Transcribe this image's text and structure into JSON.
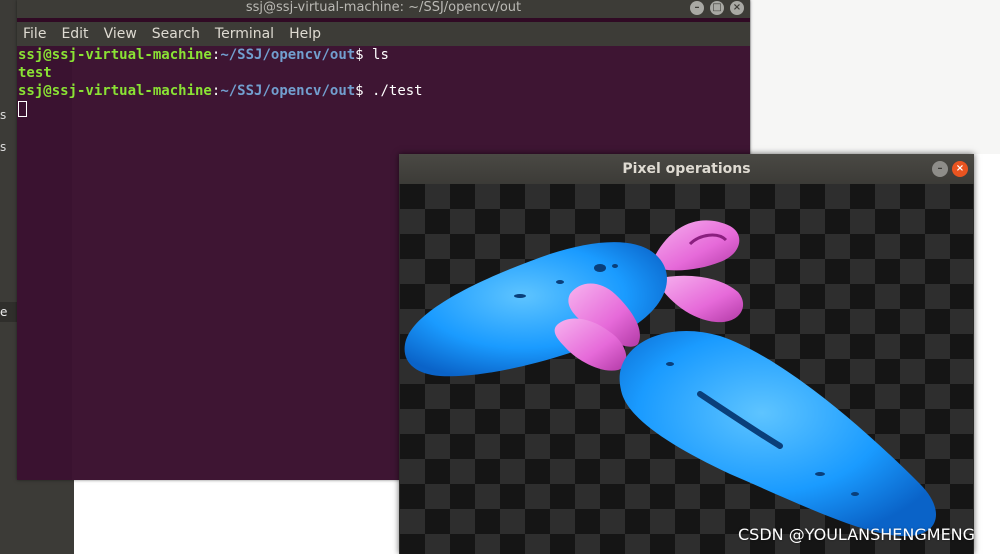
{
  "desktop": {
    "left_text_1": "s",
    "left_text_2": "s",
    "tooltip": "e"
  },
  "terminal": {
    "title": "ssj@ssj-virtual-machine: ~/SSJ/opencv/out",
    "menu": [
      "File",
      "Edit",
      "View",
      "Search",
      "Terminal",
      "Help"
    ],
    "lines": [
      {
        "user": "ssj@ssj-virtual-machine",
        "sep": ":",
        "path": "~/SSJ/opencv/out",
        "prompt": "$ ",
        "cmd": "ls"
      },
      {
        "output": "test"
      },
      {
        "user": "ssj@ssj-virtual-machine",
        "sep": ":",
        "path": "~/SSJ/opencv/out",
        "prompt": "$ ",
        "cmd": "./test"
      }
    ]
  },
  "image_window": {
    "title": "Pixel operations",
    "minimize_glyph": "–",
    "close_glyph": "×",
    "content": "carrot-image"
  },
  "watermark": "CSDN @YOULANSHENGMENG",
  "colors": {
    "terminal_bg": "#3e1533",
    "prompt_user": "#8ae234",
    "prompt_path": "#729fcf",
    "carrot_body": "#1a9bff",
    "carrot_leaves": "#e66ad9",
    "close_button": "#e95420"
  }
}
